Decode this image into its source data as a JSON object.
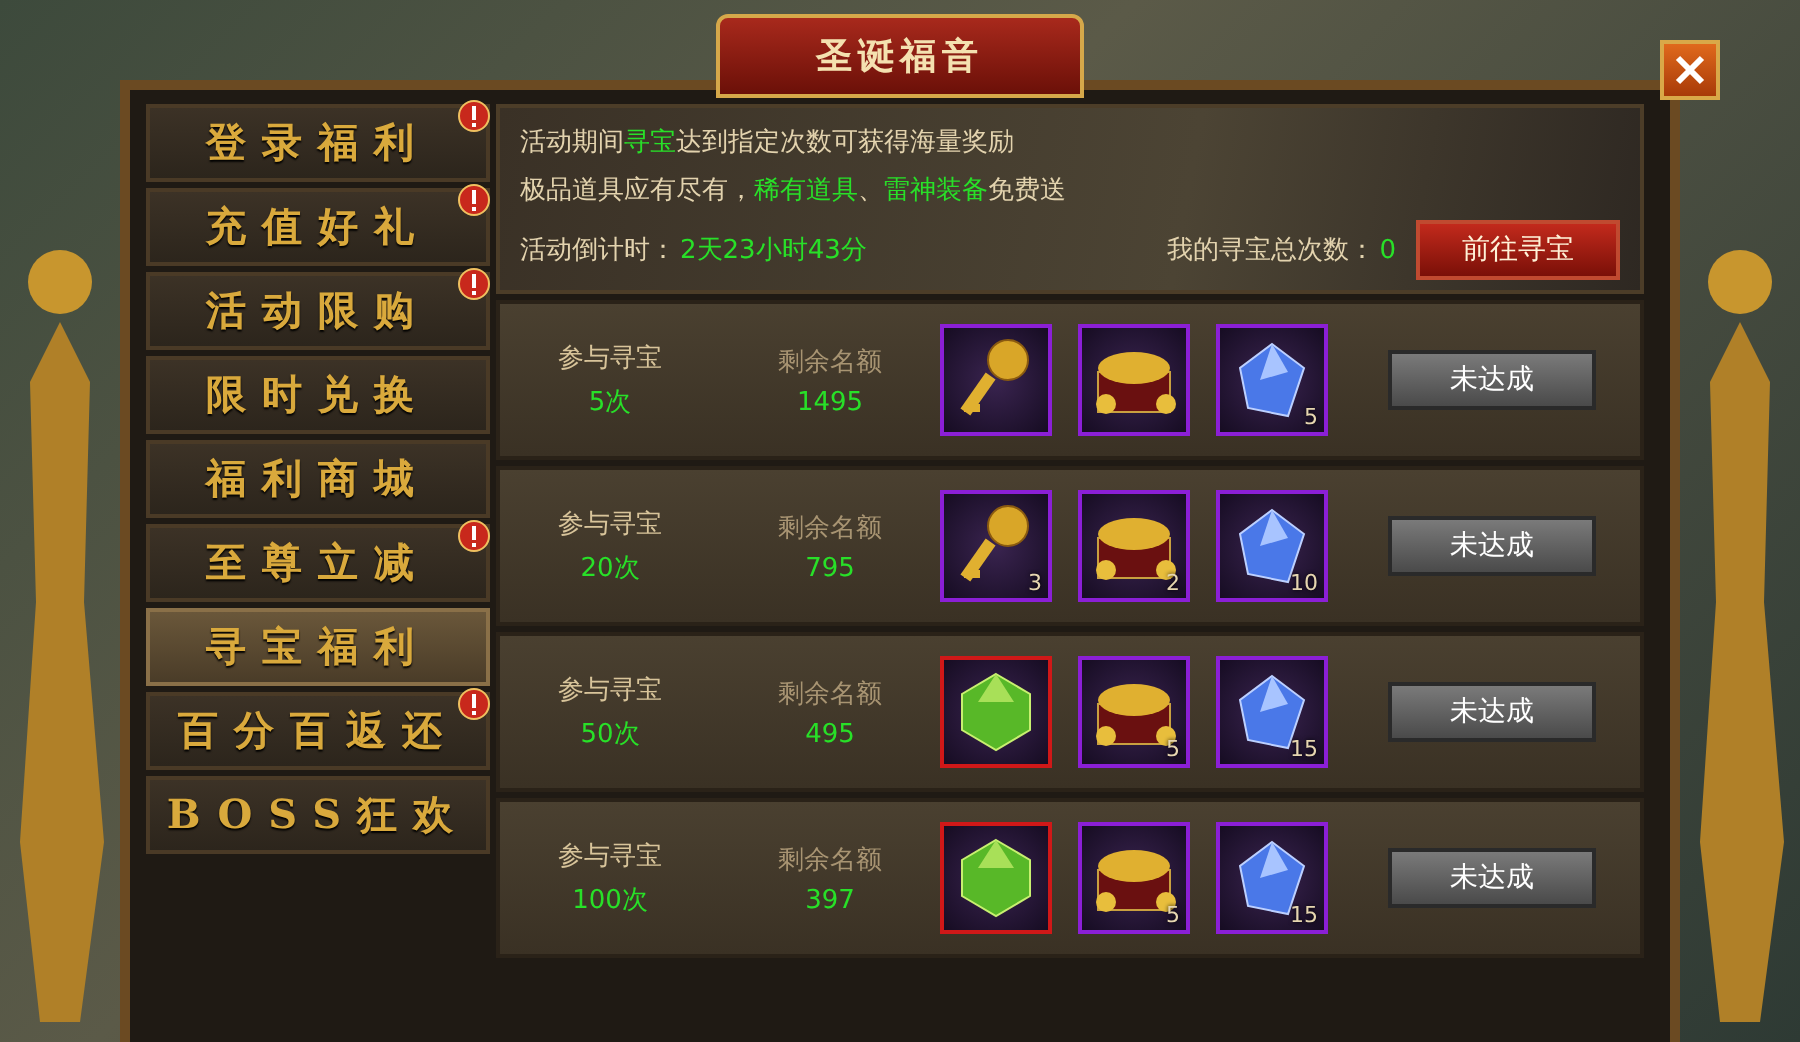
{
  "window": {
    "title": "圣诞福音"
  },
  "sidebar": {
    "items": [
      {
        "label": "登录福利",
        "selected": false,
        "alert": true
      },
      {
        "label": "充值好礼",
        "selected": false,
        "alert": true
      },
      {
        "label": "活动限购",
        "selected": false,
        "alert": true
      },
      {
        "label": "限时兑换",
        "selected": false,
        "alert": false
      },
      {
        "label": "福利商城",
        "selected": false,
        "alert": false
      },
      {
        "label": "至尊立减",
        "selected": false,
        "alert": true
      },
      {
        "label": "寻宝福利",
        "selected": true,
        "alert": false
      },
      {
        "label": "百分百返还",
        "selected": false,
        "alert": true
      },
      {
        "label": "BOSS狂欢",
        "selected": false,
        "alert": false
      }
    ]
  },
  "info": {
    "lines": [
      [
        {
          "text": "活动期间",
          "highlight": false
        },
        {
          "text": "寻宝",
          "highlight": true
        },
        {
          "text": "达到指定次数可获得海量奖励",
          "highlight": false
        }
      ],
      [
        {
          "text": "极品道具应有尽有，",
          "highlight": false
        },
        {
          "text": "稀有道具",
          "highlight": true
        },
        {
          "text": "、",
          "highlight": false
        },
        {
          "text": "雷神装备",
          "highlight": true
        },
        {
          "text": "免费送",
          "highlight": false
        }
      ]
    ],
    "countdown_label": "活动倒计时：",
    "countdown_value": "2天23小时43分",
    "total_label": "我的寻宝总次数：",
    "total_value": "0",
    "go_button": "前往寻宝"
  },
  "rows": [
    {
      "times_label": "参与寻宝",
      "times": "5次",
      "quota_label": "剩余名额",
      "quota": "1495",
      "button": "未达成",
      "items": [
        {
          "kind": "key",
          "color": "#8b1fd6"
        },
        {
          "kind": "chest",
          "color": "#8b1fd6"
        },
        {
          "kind": "crystal",
          "color": "#8b1fd6",
          "count": "5"
        }
      ]
    },
    {
      "times_label": "参与寻宝",
      "times": "20次",
      "quota_label": "剩余名额",
      "quota": "795",
      "button": "未达成",
      "items": [
        {
          "kind": "key",
          "color": "#8b1fd6",
          "count": "3"
        },
        {
          "kind": "chest",
          "color": "#8b1fd6",
          "count": "2"
        },
        {
          "kind": "crystal",
          "color": "#8b1fd6",
          "count": "10"
        }
      ]
    },
    {
      "times_label": "参与寻宝",
      "times": "50次",
      "quota_label": "剩余名额",
      "quota": "495",
      "button": "未达成",
      "items": [
        {
          "kind": "gem",
          "color": "#d01818"
        },
        {
          "kind": "chest",
          "color": "#8b1fd6",
          "count": "5"
        },
        {
          "kind": "crystal",
          "color": "#8b1fd6",
          "count": "15"
        }
      ]
    },
    {
      "times_label": "参与寻宝",
      "times": "100次",
      "quota_label": "剩余名额",
      "quota": "397",
      "button": "未达成",
      "items": [
        {
          "kind": "gem",
          "color": "#d01818"
        },
        {
          "kind": "chest",
          "color": "#8b1fd6",
          "count": "5"
        },
        {
          "kind": "crystal",
          "color": "#8b1fd6",
          "count": "15"
        }
      ]
    }
  ]
}
